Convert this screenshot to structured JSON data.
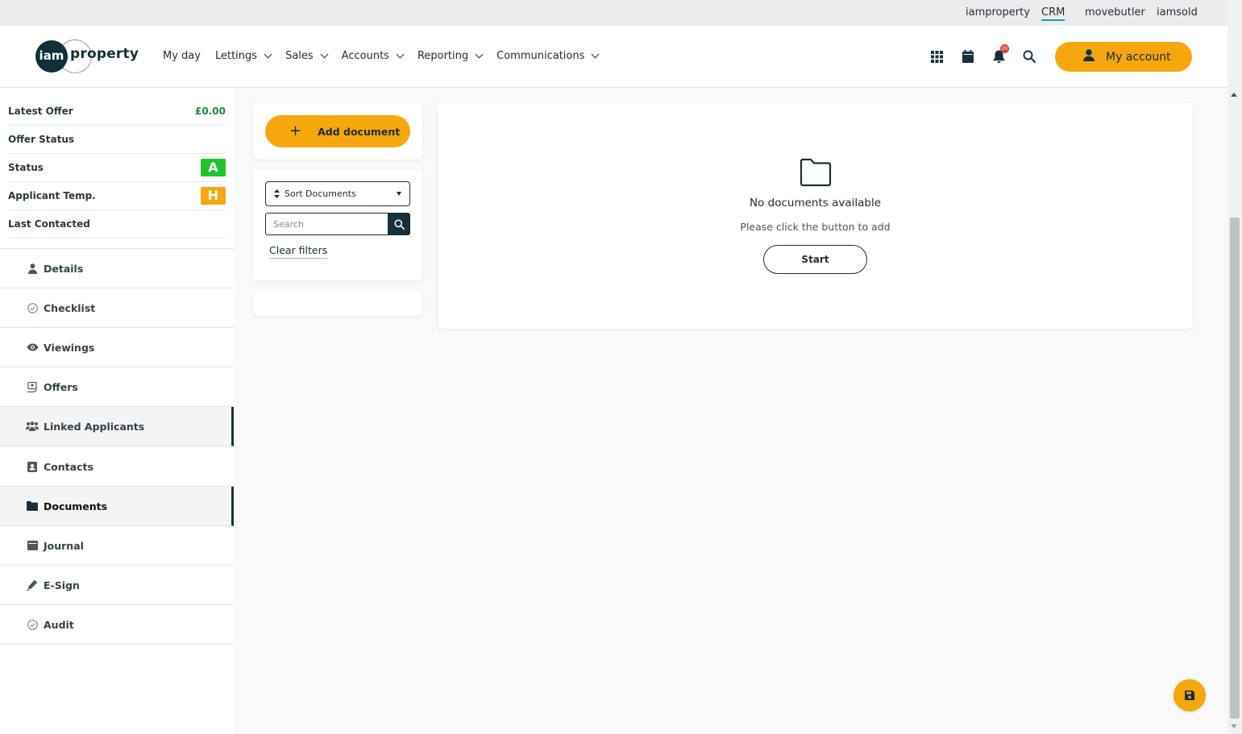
{
  "topbar": {
    "links": [
      "iamproperty",
      "CRM",
      "movebutler",
      "iamsold"
    ],
    "active": "CRM"
  },
  "header": {
    "logo": {
      "mark": "iam",
      "word": "property"
    },
    "nav": [
      {
        "label": "My day"
      },
      {
        "label": "Lettings"
      },
      {
        "label": "Sales"
      },
      {
        "label": "Accounts"
      },
      {
        "label": "Reporting"
      },
      {
        "label": "Communications"
      }
    ],
    "icons": [
      "apps-grid-icon",
      "calendar-icon",
      "bell-icon",
      "search-icon"
    ],
    "notification_count": "20",
    "account_label": "My account"
  },
  "info": {
    "latest_offer": {
      "label": "Latest Offer",
      "value": "£0.00"
    },
    "offer_status": {
      "label": "Offer Status"
    },
    "status": {
      "label": "Status",
      "tag": "A",
      "color": "#1ec42a"
    },
    "applicant_temp": {
      "label": "Applicant Temp.",
      "tag": "H",
      "color": "#f6a70e"
    },
    "last_contacted": {
      "label": "Last Contacted"
    }
  },
  "menu": [
    {
      "label": "Details",
      "icon": "person-icon"
    },
    {
      "label": "Checklist",
      "icon": "check-circle-icon"
    },
    {
      "label": "Viewings",
      "icon": "eye-icon"
    },
    {
      "label": "Offers",
      "icon": "offer-icon"
    },
    {
      "label": "Linked Applicants",
      "icon": "users-icon"
    },
    {
      "label": "Contacts",
      "icon": "contact-card-icon"
    },
    {
      "label": "Documents",
      "icon": "folder-icon"
    },
    {
      "label": "Journal",
      "icon": "journal-icon"
    },
    {
      "label": "E-Sign",
      "icon": "pen-icon"
    },
    {
      "label": "Audit",
      "icon": "check-circle-icon"
    }
  ],
  "documents": {
    "add_label": "Add document",
    "sort_label": "Sort Documents",
    "search_placeholder": "Search",
    "clear_filters": "Clear filters",
    "empty_title": "No documents available",
    "empty_subtitle": "Please click the button to add",
    "start_label": "Start"
  },
  "colors": {
    "accent": "#f6a70e",
    "dark": "#17313b",
    "status_green": "#1ec42a",
    "offer_green": "#178a3e"
  }
}
